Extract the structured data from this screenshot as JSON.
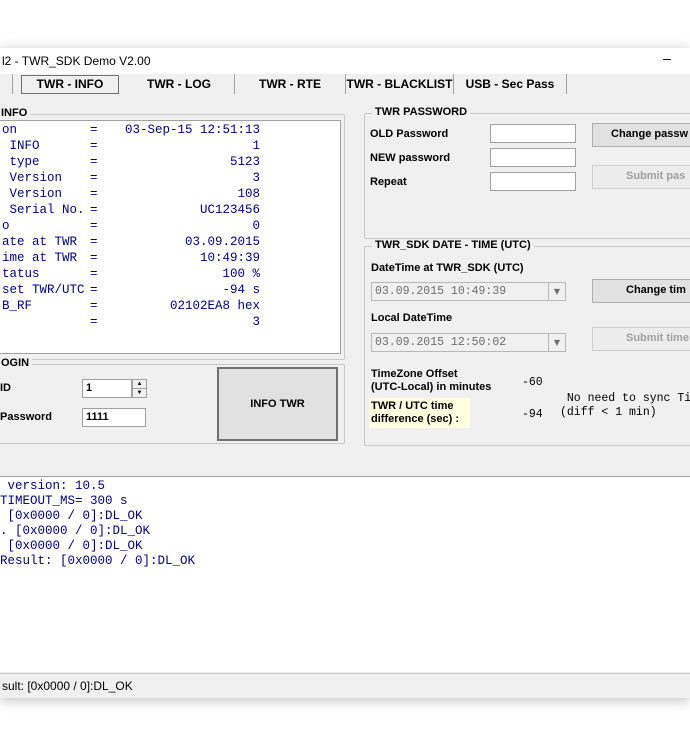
{
  "window": {
    "title": "l2  - TWR_SDK Demo V2.00",
    "minimize": "–"
  },
  "tabs": [
    {
      "label": "TWR - INFO"
    },
    {
      "label": "TWR - LOG"
    },
    {
      "label": "TWR - RTE"
    },
    {
      "label": "TWR - BLACKLIST"
    },
    {
      "label": "USB - Sec Pass"
    }
  ],
  "info": {
    "group_title": "INFO",
    "rows": [
      {
        "label": "on",
        "value": "03-Sep-15 12:51:13"
      },
      {
        "label": " INFO",
        "value": "1"
      },
      {
        "label": " type",
        "value": "5123"
      },
      {
        "label": " Version",
        "value": "3"
      },
      {
        "label": " Version",
        "value": "108"
      },
      {
        "label": " Serial No.",
        "value": "UC123456"
      },
      {
        "label": "o",
        "value": "0"
      },
      {
        "label": "ate at TWR",
        "value": "03.09.2015"
      },
      {
        "label": "ime at TWR",
        "value": "10:49:39"
      },
      {
        "label": "tatus",
        "value": "100 %"
      },
      {
        "label": "set TWR/UTC",
        "value": "-94 s"
      },
      {
        "label": "B_RF",
        "value": "02102EA8 hex"
      },
      {
        "label": "",
        "value": "3"
      }
    ]
  },
  "login": {
    "group_title": "OGIN",
    "id_label": "ID",
    "id_value": "1",
    "password_label": "Password",
    "password_value": "1111",
    "info_button": "INFO TWR"
  },
  "password": {
    "group_title": "TWR PASSWORD",
    "old_label": "OLD Password",
    "new_label": "NEW password",
    "repeat_label": "Repeat",
    "change_button": "Change passw",
    "submit_button": "Submit pas"
  },
  "datetime": {
    "group_title": "TWR_SDK DATE - TIME  (UTC)",
    "sdk_label": "DateTime at TWR_SDK (UTC)",
    "sdk_value": "03.09.2015 10:49:39",
    "local_label": "Local DateTime",
    "local_value": "03.09.2015 12:50:02",
    "change_button": "Change tim",
    "submit_button": "Submit time",
    "tz_label_1": "TimeZone Offset",
    "tz_label_2": "(UTC-Local) in minutes",
    "tz_value": "-60",
    "diff_label_1": "TWR / UTC time",
    "diff_label_2": "difference (sec) :",
    "diff_value": "-94",
    "sync_msg_1": " No need to sync Ti",
    "sync_msg_2": "(diff < 1 min)"
  },
  "log": {
    "lines": [
      " version: 10.5",
      "TIMEOUT_MS= 300 s",
      " [0x0000 / 0]:DL_OK",
      ". [0x0000 / 0]:DL_OK",
      " [0x0000 / 0]:DL_OK",
      "Result: [0x0000 / 0]:DL_OK"
    ]
  },
  "status": {
    "text": "sult: [0x0000 / 0]:DL_OK"
  },
  "colors": {
    "log_text": "#000080",
    "window_bg": "#f0f0f0"
  }
}
